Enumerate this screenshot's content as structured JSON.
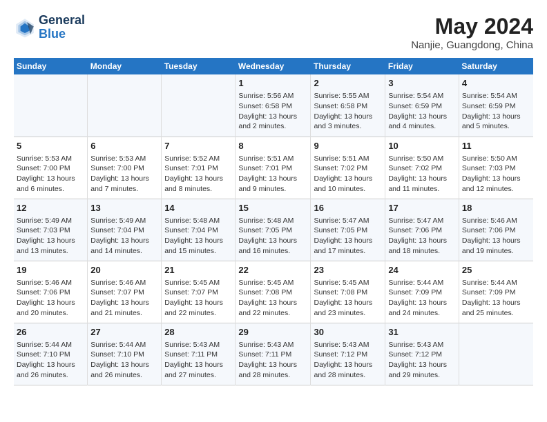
{
  "header": {
    "logo_line1": "General",
    "logo_line2": "Blue",
    "month_year": "May 2024",
    "location": "Nanjie, Guangdong, China"
  },
  "days_of_week": [
    "Sunday",
    "Monday",
    "Tuesday",
    "Wednesday",
    "Thursday",
    "Friday",
    "Saturday"
  ],
  "weeks": [
    [
      {
        "day": "",
        "info": ""
      },
      {
        "day": "",
        "info": ""
      },
      {
        "day": "",
        "info": ""
      },
      {
        "day": "1",
        "info": "Sunrise: 5:56 AM\nSunset: 6:58 PM\nDaylight: 13 hours\nand 2 minutes."
      },
      {
        "day": "2",
        "info": "Sunrise: 5:55 AM\nSunset: 6:58 PM\nDaylight: 13 hours\nand 3 minutes."
      },
      {
        "day": "3",
        "info": "Sunrise: 5:54 AM\nSunset: 6:59 PM\nDaylight: 13 hours\nand 4 minutes."
      },
      {
        "day": "4",
        "info": "Sunrise: 5:54 AM\nSunset: 6:59 PM\nDaylight: 13 hours\nand 5 minutes."
      }
    ],
    [
      {
        "day": "5",
        "info": "Sunrise: 5:53 AM\nSunset: 7:00 PM\nDaylight: 13 hours\nand 6 minutes."
      },
      {
        "day": "6",
        "info": "Sunrise: 5:53 AM\nSunset: 7:00 PM\nDaylight: 13 hours\nand 7 minutes."
      },
      {
        "day": "7",
        "info": "Sunrise: 5:52 AM\nSunset: 7:01 PM\nDaylight: 13 hours\nand 8 minutes."
      },
      {
        "day": "8",
        "info": "Sunrise: 5:51 AM\nSunset: 7:01 PM\nDaylight: 13 hours\nand 9 minutes."
      },
      {
        "day": "9",
        "info": "Sunrise: 5:51 AM\nSunset: 7:02 PM\nDaylight: 13 hours\nand 10 minutes."
      },
      {
        "day": "10",
        "info": "Sunrise: 5:50 AM\nSunset: 7:02 PM\nDaylight: 13 hours\nand 11 minutes."
      },
      {
        "day": "11",
        "info": "Sunrise: 5:50 AM\nSunset: 7:03 PM\nDaylight: 13 hours\nand 12 minutes."
      }
    ],
    [
      {
        "day": "12",
        "info": "Sunrise: 5:49 AM\nSunset: 7:03 PM\nDaylight: 13 hours\nand 13 minutes."
      },
      {
        "day": "13",
        "info": "Sunrise: 5:49 AM\nSunset: 7:04 PM\nDaylight: 13 hours\nand 14 minutes."
      },
      {
        "day": "14",
        "info": "Sunrise: 5:48 AM\nSunset: 7:04 PM\nDaylight: 13 hours\nand 15 minutes."
      },
      {
        "day": "15",
        "info": "Sunrise: 5:48 AM\nSunset: 7:05 PM\nDaylight: 13 hours\nand 16 minutes."
      },
      {
        "day": "16",
        "info": "Sunrise: 5:47 AM\nSunset: 7:05 PM\nDaylight: 13 hours\nand 17 minutes."
      },
      {
        "day": "17",
        "info": "Sunrise: 5:47 AM\nSunset: 7:06 PM\nDaylight: 13 hours\nand 18 minutes."
      },
      {
        "day": "18",
        "info": "Sunrise: 5:46 AM\nSunset: 7:06 PM\nDaylight: 13 hours\nand 19 minutes."
      }
    ],
    [
      {
        "day": "19",
        "info": "Sunrise: 5:46 AM\nSunset: 7:06 PM\nDaylight: 13 hours\nand 20 minutes."
      },
      {
        "day": "20",
        "info": "Sunrise: 5:46 AM\nSunset: 7:07 PM\nDaylight: 13 hours\nand 21 minutes."
      },
      {
        "day": "21",
        "info": "Sunrise: 5:45 AM\nSunset: 7:07 PM\nDaylight: 13 hours\nand 22 minutes."
      },
      {
        "day": "22",
        "info": "Sunrise: 5:45 AM\nSunset: 7:08 PM\nDaylight: 13 hours\nand 22 minutes."
      },
      {
        "day": "23",
        "info": "Sunrise: 5:45 AM\nSunset: 7:08 PM\nDaylight: 13 hours\nand 23 minutes."
      },
      {
        "day": "24",
        "info": "Sunrise: 5:44 AM\nSunset: 7:09 PM\nDaylight: 13 hours\nand 24 minutes."
      },
      {
        "day": "25",
        "info": "Sunrise: 5:44 AM\nSunset: 7:09 PM\nDaylight: 13 hours\nand 25 minutes."
      }
    ],
    [
      {
        "day": "26",
        "info": "Sunrise: 5:44 AM\nSunset: 7:10 PM\nDaylight: 13 hours\nand 26 minutes."
      },
      {
        "day": "27",
        "info": "Sunrise: 5:44 AM\nSunset: 7:10 PM\nDaylight: 13 hours\nand 26 minutes."
      },
      {
        "day": "28",
        "info": "Sunrise: 5:43 AM\nSunset: 7:11 PM\nDaylight: 13 hours\nand 27 minutes."
      },
      {
        "day": "29",
        "info": "Sunrise: 5:43 AM\nSunset: 7:11 PM\nDaylight: 13 hours\nand 28 minutes."
      },
      {
        "day": "30",
        "info": "Sunrise: 5:43 AM\nSunset: 7:12 PM\nDaylight: 13 hours\nand 28 minutes."
      },
      {
        "day": "31",
        "info": "Sunrise: 5:43 AM\nSunset: 7:12 PM\nDaylight: 13 hours\nand 29 minutes."
      },
      {
        "day": "",
        "info": ""
      }
    ]
  ]
}
